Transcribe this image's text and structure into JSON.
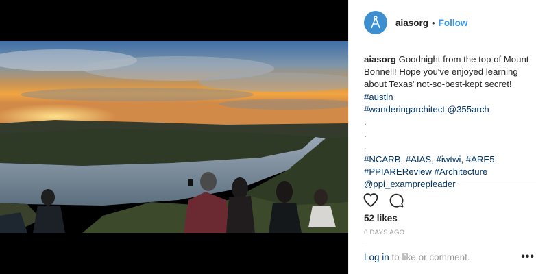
{
  "post": {
    "username": "aiasorg",
    "follow_label": "Follow",
    "separator": "•",
    "caption_parts": [
      {
        "text": "aiasorg",
        "kind": "user"
      },
      {
        "text": " Goodnight from the top of Mount Bonnell! Hope you've enjoyed learning about Texas' not-so-best-kept secret! ",
        "kind": "text"
      },
      {
        "text": "#austin",
        "kind": "tag"
      },
      {
        "text": "\n",
        "kind": "text"
      },
      {
        "text": "#wanderingarchitect",
        "kind": "tag"
      },
      {
        "text": " ",
        "kind": "text"
      },
      {
        "text": "@355arch",
        "kind": "tag"
      },
      {
        "text": "\n.\n.\n.\n",
        "kind": "text"
      },
      {
        "text": "#NCARB",
        "kind": "tag"
      },
      {
        "text": ", ",
        "kind": "text"
      },
      {
        "text": "#AIAS",
        "kind": "tag"
      },
      {
        "text": ", ",
        "kind": "text"
      },
      {
        "text": "#iwtwi",
        "kind": "tag"
      },
      {
        "text": ", ",
        "kind": "text"
      },
      {
        "text": "#ARE5",
        "kind": "tag"
      },
      {
        "text": ",\n",
        "kind": "text"
      },
      {
        "text": "#PPIAREReview",
        "kind": "tag"
      },
      {
        "text": " ",
        "kind": "text"
      },
      {
        "text": "#Architecture",
        "kind": "tag"
      },
      {
        "text": "\n",
        "kind": "text"
      },
      {
        "text": "@ppi_examprepleader",
        "kind": "tag"
      }
    ],
    "likes": "52 likes",
    "timestamp": "6 DAYS AGO",
    "login_link": "Log in",
    "login_rest": " to like or comment.",
    "more_label": "•••"
  },
  "icons": {
    "like": "heart-icon",
    "comment": "comment-bubble-icon",
    "more": "more-options-icon",
    "avatar": "compass-logo-icon"
  },
  "colors": {
    "avatar_bg": "#3d8fcf",
    "link": "#3897f0",
    "tag": "#003569"
  }
}
